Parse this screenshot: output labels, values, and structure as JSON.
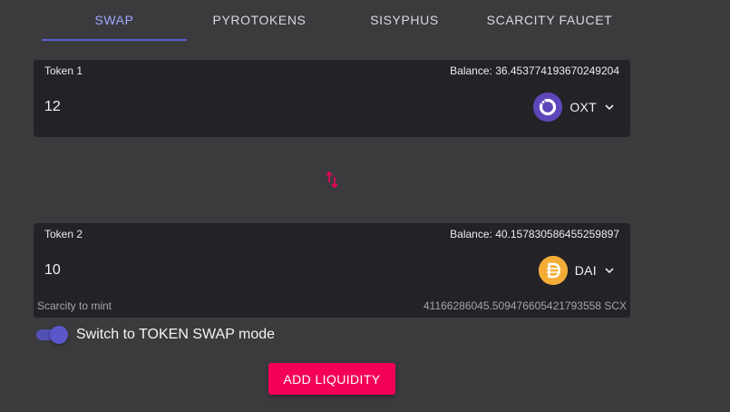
{
  "tabs": [
    {
      "label": "SWAP",
      "active": true
    },
    {
      "label": "PYROTOKENS",
      "active": false
    },
    {
      "label": "SISYPHUS",
      "active": false
    },
    {
      "label": "SCARCITY FAUCET",
      "active": false
    }
  ],
  "token1": {
    "label": "Token 1",
    "balance": "Balance: 36.453774193670249204",
    "amount": "12",
    "symbol": "OXT",
    "icon": "oxt-token-icon",
    "icon_color": "#5f45ba"
  },
  "token2": {
    "label": "Token 2",
    "balance": "Balance: 40.157830586455259897",
    "amount": "10",
    "symbol": "DAI",
    "icon": "dai-token-icon",
    "icon_color": "#f5ac37"
  },
  "scarcity": {
    "label": "Scarcity to mint",
    "value": "41166286045.509476605421793558 SCX"
  },
  "swap_icon": "swap-arrows-icon",
  "mode_toggle": {
    "label": "Switch to TOKEN SWAP mode",
    "on": true
  },
  "action": {
    "label": "ADD LIQUIDITY"
  },
  "colors": {
    "background": "#3b3b3e",
    "panel": "#232327",
    "accent": "#5c5cd6",
    "button": "#f50057",
    "swap_arrows": "#f50057"
  }
}
